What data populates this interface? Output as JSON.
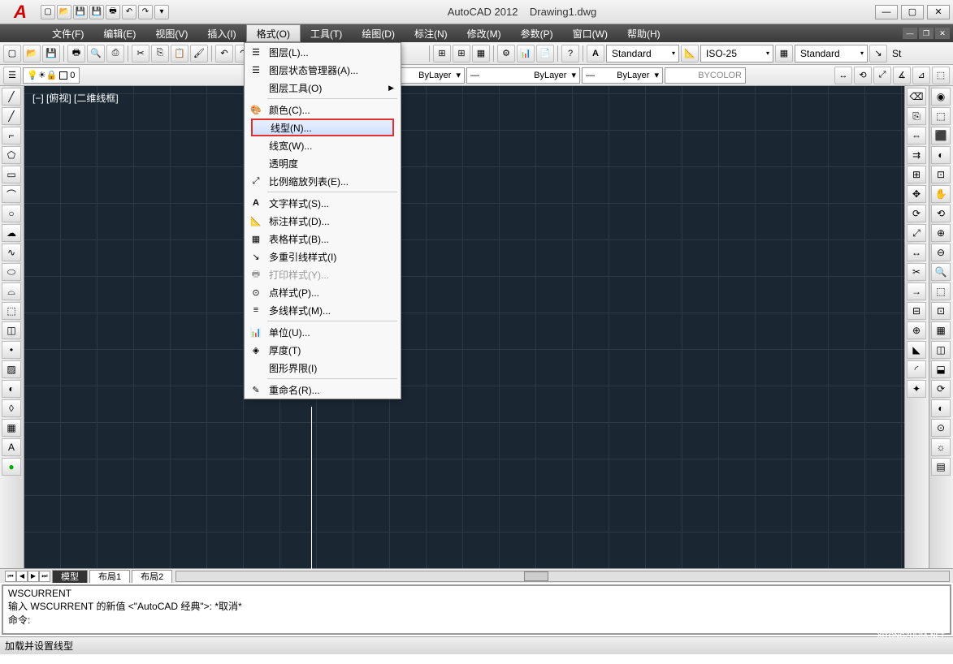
{
  "titlebar": {
    "app": "AutoCAD 2012",
    "file": "Drawing1.dwg"
  },
  "menubar": {
    "items": [
      {
        "label": "文件(F)"
      },
      {
        "label": "编辑(E)"
      },
      {
        "label": "视图(V)"
      },
      {
        "label": "插入(I)"
      },
      {
        "label": "格式(O)",
        "active": true
      },
      {
        "label": "工具(T)"
      },
      {
        "label": "绘图(D)"
      },
      {
        "label": "标注(N)"
      },
      {
        "label": "修改(M)"
      },
      {
        "label": "参数(P)"
      },
      {
        "label": "窗口(W)"
      },
      {
        "label": "帮助(H)"
      }
    ]
  },
  "dropdown": {
    "items": [
      {
        "label": "图层(L)...",
        "icon": "layers-icon"
      },
      {
        "label": "图层状态管理器(A)...",
        "icon": "layer-state-icon"
      },
      {
        "label": "图层工具(O)",
        "submenu": true
      },
      {
        "sep": true
      },
      {
        "label": "颜色(C)...",
        "icon": "palette-icon"
      },
      {
        "label": "线型(N)...",
        "highlight": true,
        "hover": true
      },
      {
        "label": "线宽(W)..."
      },
      {
        "label": "透明度"
      },
      {
        "label": "比例缩放列表(E)...",
        "icon": "scale-icon"
      },
      {
        "sep": true
      },
      {
        "label": "文字样式(S)...",
        "icon": "text-style-icon"
      },
      {
        "label": "标注样式(D)...",
        "icon": "dim-style-icon"
      },
      {
        "label": "表格样式(B)...",
        "icon": "table-style-icon"
      },
      {
        "label": "多重引线样式(I)",
        "icon": "mleader-icon"
      },
      {
        "label": "打印样式(Y)...",
        "icon": "print-style-icon",
        "disabled": true
      },
      {
        "label": "点样式(P)...",
        "icon": "point-style-icon"
      },
      {
        "label": "多线样式(M)...",
        "icon": "mline-icon"
      },
      {
        "sep": true
      },
      {
        "label": "单位(U)...",
        "icon": "units-icon"
      },
      {
        "label": "厚度(T)",
        "icon": "thickness-icon"
      },
      {
        "label": "图形界限(I)"
      },
      {
        "sep": true
      },
      {
        "label": "重命名(R)...",
        "icon": "rename-icon"
      }
    ]
  },
  "toolbar": {
    "style1": "Standard",
    "style2": "ISO-25",
    "style3": "Standard",
    "style4_short": "St"
  },
  "layerbar": {
    "layer": "0",
    "bylayer1": "ByLayer",
    "bylayer2": "ByLayer",
    "bycolor": "BYCOLOR"
  },
  "canvas": {
    "label": "[−] [俯视] [二维线框]"
  },
  "tabs": {
    "model": "模型",
    "layout1": "布局1",
    "layout2": "布局2"
  },
  "command": {
    "line1": "WSCURRENT",
    "line2": "输入 WSCURRENT 的新值 <\"AutoCAD 经典\">: *取消*",
    "line3": "",
    "prompt": "命令:"
  },
  "status": {
    "text": "加载并设置线型"
  },
  "watermark": {
    "brand": "系统之家",
    "url": "XITONGZHIJIA.NET"
  }
}
